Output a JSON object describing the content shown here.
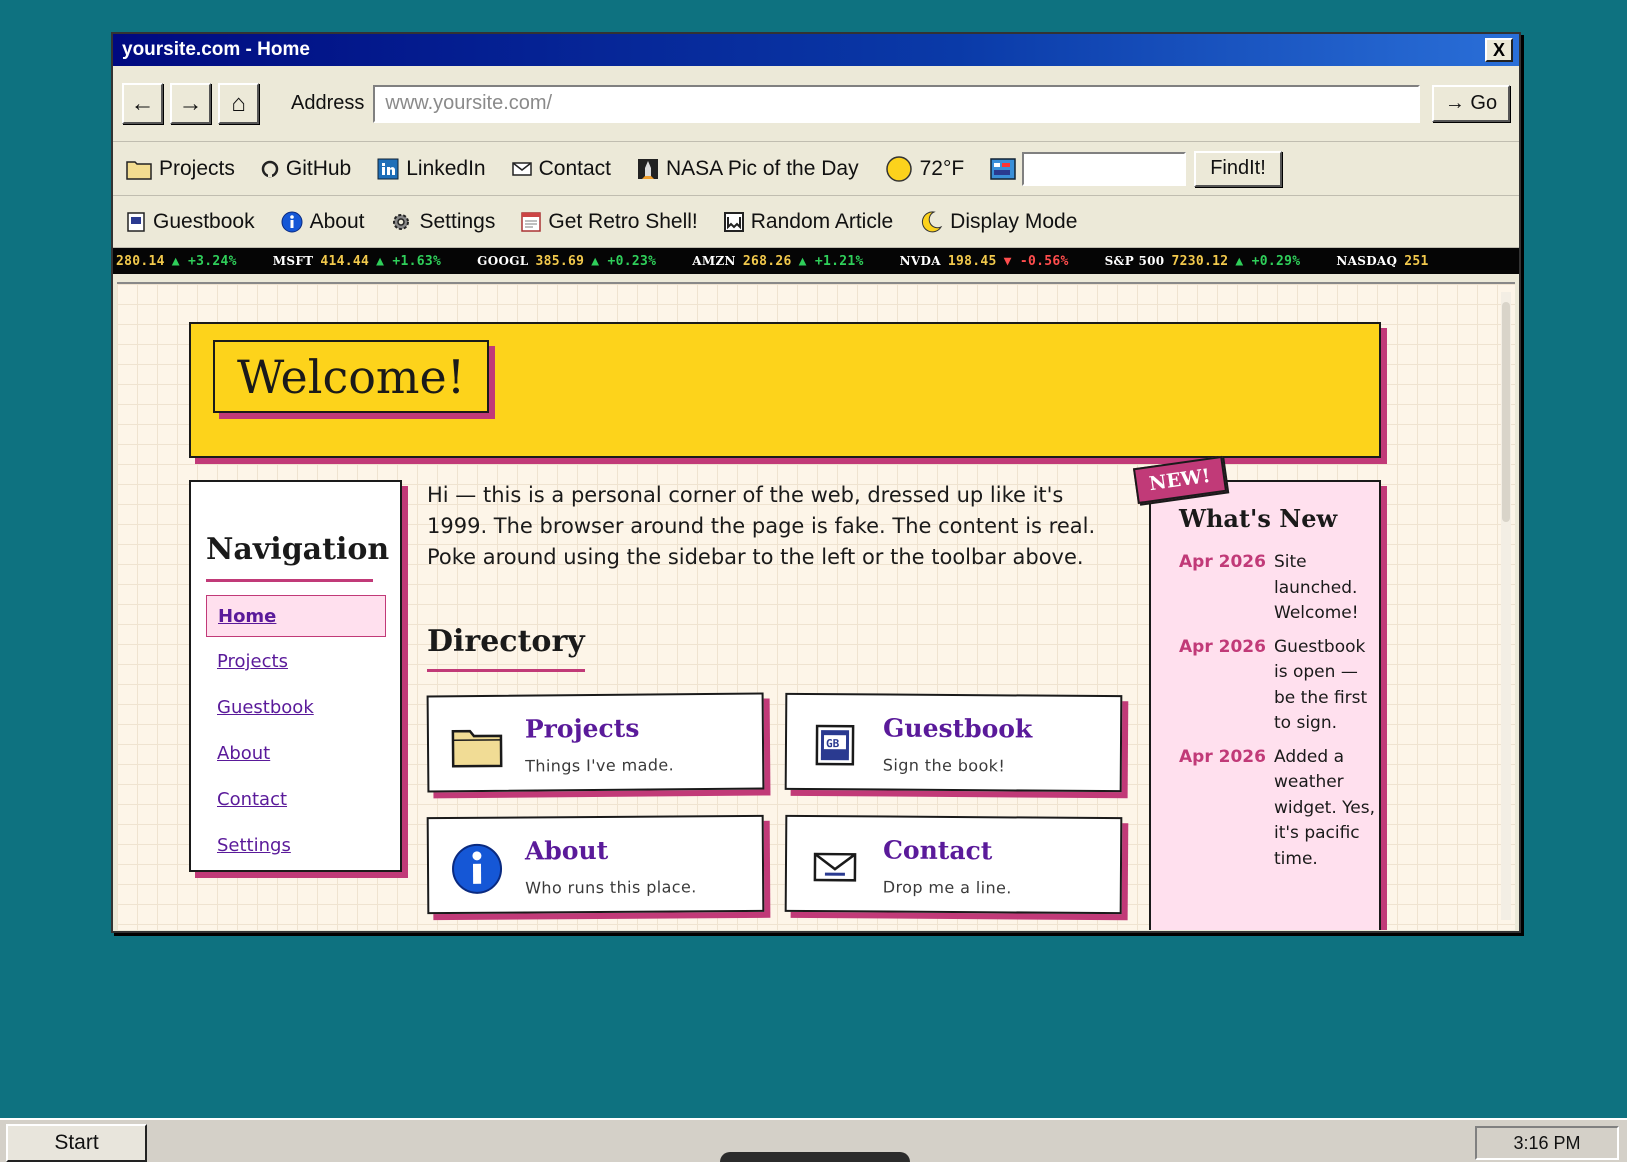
{
  "window": {
    "title": "yoursite.com - Home",
    "close_label": "X"
  },
  "navbar": {
    "back": "←",
    "forward": "→",
    "home": "⌂",
    "address_label": "Address",
    "address_value": "www.yoursite.com/",
    "go_label": "→ Go"
  },
  "toolbar1": {
    "projects": "Projects",
    "github": "GitHub",
    "linkedin": "LinkedIn",
    "contact": "Contact",
    "nasa": "NASA Pic of the Day",
    "weather": "72°F",
    "find_label": "FindIt!",
    "find_value": ""
  },
  "toolbar2": {
    "guestbook": "Guestbook",
    "about": "About",
    "settings": "Settings",
    "retro": "Get Retro Shell!",
    "random": "Random Article",
    "display": "Display Mode"
  },
  "ticker": [
    {
      "sym": "",
      "price": "280.14",
      "change": "▲ +3.24%",
      "dir": "up"
    },
    {
      "sym": "MSFT",
      "price": "414.44",
      "change": "▲ +1.63%",
      "dir": "up"
    },
    {
      "sym": "GOOGL",
      "price": "385.69",
      "change": "▲ +0.23%",
      "dir": "up"
    },
    {
      "sym": "AMZN",
      "price": "268.26",
      "change": "▲ +1.21%",
      "dir": "up"
    },
    {
      "sym": "NVDA",
      "price": "198.45",
      "change": "▼ -0.56%",
      "dir": "down"
    },
    {
      "sym": "S&P 500",
      "price": "7230.12",
      "change": "▲ +0.29%",
      "dir": "up"
    },
    {
      "sym": "NASDAQ",
      "price": "251",
      "change": "",
      "dir": "up"
    }
  ],
  "page": {
    "welcome": "Welcome!",
    "intro": "Hi — this is a personal corner of the web, dressed up like it's 1999. The browser around the page is fake. The content is real. Poke around using the sidebar to the left or the toolbar above.",
    "directory_heading": "Directory",
    "navigation": {
      "heading": "Navigation",
      "items": [
        "Home",
        "Projects",
        "Guestbook",
        "About",
        "Contact",
        "Settings"
      ]
    },
    "cards": [
      {
        "title": "Projects",
        "sub": "Things I've made."
      },
      {
        "title": "Guestbook",
        "sub": "Sign the book!"
      },
      {
        "title": "About",
        "sub": "Who runs this place."
      },
      {
        "title": "Contact",
        "sub": "Drop me a line."
      }
    ],
    "whats_new": {
      "badge": "NEW!",
      "heading": "What's New",
      "items": [
        {
          "date": "Apr 2026",
          "text": "Site launched. Welcome!"
        },
        {
          "date": "Apr 2026",
          "text": "Guestbook is open — be the first to sign."
        },
        {
          "date": "Apr 2026",
          "text": "Added a weather widget. Yes, it's pacific time."
        }
      ]
    }
  },
  "taskbar": {
    "start": "Start",
    "clock": "3:16 PM"
  },
  "colors": {
    "desktop": "#0e7280",
    "accent": "#c13a78",
    "banner": "#fdd31b",
    "link": "#5a1a9a"
  }
}
